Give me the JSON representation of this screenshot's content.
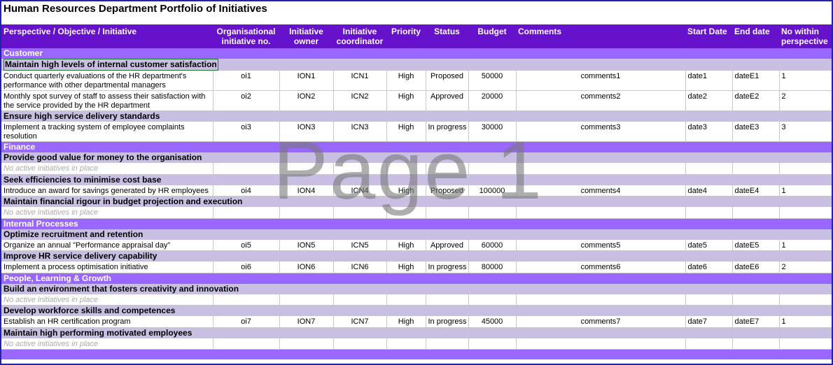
{
  "title": "Human Resources Department Portfolio of Initiatives",
  "watermark": "Page 1",
  "headers": {
    "col1": "Perspective / Objective / Initiative",
    "col2": "Organisational initiative no.",
    "col3": "Initiative owner",
    "col4": "Initiative coordinator",
    "col5": "Priority",
    "col6": "Status",
    "col7": "Budget",
    "col8": "Comments",
    "col9": "Start Date",
    "col10": "End date",
    "col11": "No within perspective"
  },
  "empty_text": "No active initiatives in place",
  "perspectives": [
    {
      "name": "Customer"
    },
    {
      "name": "Finance"
    },
    {
      "name": "Internal Processes"
    },
    {
      "name": "People, Learning & Growth"
    }
  ],
  "objectives": [
    "Maintain high levels of internal customer satisfaction",
    "Ensure high service delivery standards",
    "Provide good value for money to the organisation",
    "Seek efficiencies to minimise cost base",
    "Maintain financial rigour in budget projection and execution",
    "Optimize recruitment and retention",
    "Improve HR service delivery capability",
    "Build an environment that fosters creativity and innovation",
    "Develop workforce skills and competences",
    "Maintain high performing motivated employees"
  ],
  "initiatives": [
    {
      "name": "Conduct quarterly evaluations of the HR department's performance with other departmental managers",
      "no": "oi1",
      "owner": "ION1",
      "coord": "ICN1",
      "priority": "High",
      "status": "Proposed",
      "budget": "50000",
      "comments": "comments1",
      "start": "date1",
      "end": "dateE1",
      "num": "1"
    },
    {
      "name": "Monthly spot survey of staff to assess their satisfaction with the service provided by the HR department",
      "no": "oi2",
      "owner": "ION2",
      "coord": "ICN2",
      "priority": "High",
      "status": "Approved",
      "budget": "20000",
      "comments": "comments2",
      "start": "date2",
      "end": "dateE2",
      "num": "2"
    },
    {
      "name": "Implement a tracking system of employee complaints resolution",
      "no": "oi3",
      "owner": "ION3",
      "coord": "ICN3",
      "priority": "High",
      "status": "In progress",
      "budget": "30000",
      "comments": "comments3",
      "start": "date3",
      "end": "dateE3",
      "num": "3"
    },
    {
      "name": "Introduce an award for savings generated by HR employees",
      "no": "oi4",
      "owner": "ION4",
      "coord": "ICN4",
      "priority": "High",
      "status": "Proposed",
      "budget": "100000",
      "comments": "comments4",
      "start": "date4",
      "end": "dateE4",
      "num": "1"
    },
    {
      "name": "Organize an annual \"Performance appraisal day\"",
      "no": "oi5",
      "owner": "ION5",
      "coord": "ICN5",
      "priority": "High",
      "status": "Approved",
      "budget": "60000",
      "comments": "comments5",
      "start": "date5",
      "end": "dateE5",
      "num": "1"
    },
    {
      "name": "Implement a process optimisation initiative",
      "no": "oi6",
      "owner": "ION6",
      "coord": "ICN6",
      "priority": "High",
      "status": "In progress",
      "budget": "80000",
      "comments": "comments6",
      "start": "date6",
      "end": "dateE6",
      "num": "2"
    },
    {
      "name": "Establish an HR certification program",
      "no": "oi7",
      "owner": "ION7",
      "coord": "ICN7",
      "priority": "High",
      "status": "In progress",
      "budget": "45000",
      "comments": "comments7",
      "start": "date7",
      "end": "dateE7",
      "num": "1"
    }
  ]
}
